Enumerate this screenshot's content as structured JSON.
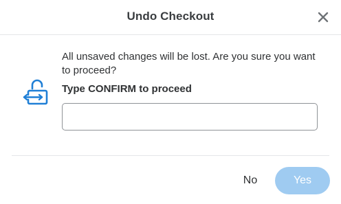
{
  "dialog": {
    "title": "Undo Checkout",
    "close_icon": "close-icon",
    "lock_icon": "unlock-exchange-icon",
    "message": "All unsaved changes will be lost. Are you sure you want to proceed?",
    "confirm_label": "Type CONFIRM to proceed",
    "confirm_input": {
      "value": "",
      "placeholder": ""
    },
    "buttons": {
      "no_label": "No",
      "yes_label": "Yes"
    }
  },
  "colors": {
    "accent": "#1f7fd6",
    "yes_button_disabled": "#9fcbf1",
    "text": "#2f3133",
    "divider": "#e4e6e8",
    "input_border": "#8e9296"
  }
}
